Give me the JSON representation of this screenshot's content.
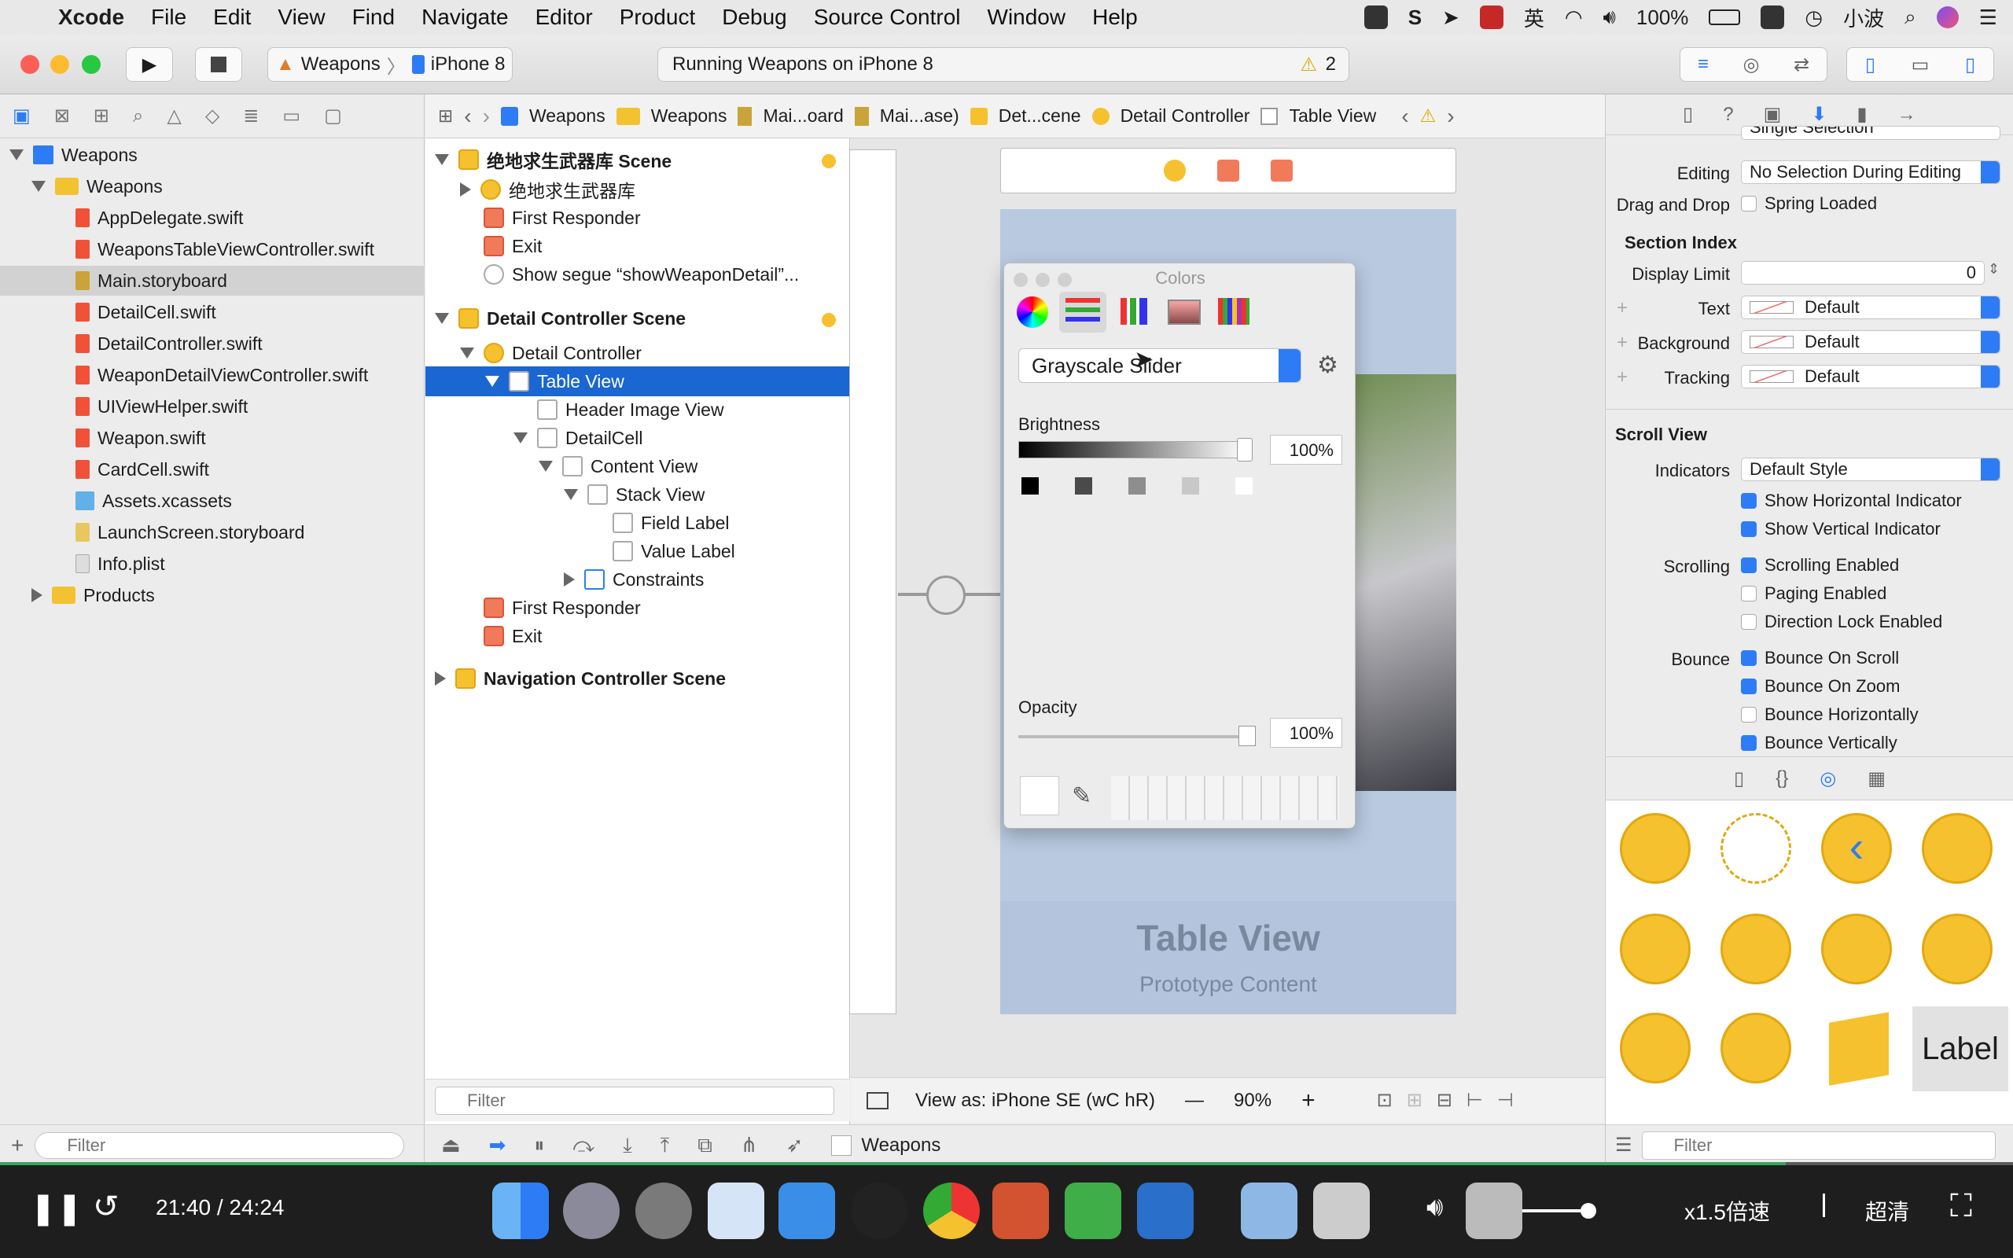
{
  "menubar": {
    "app": "Xcode",
    "items": [
      "File",
      "Edit",
      "View",
      "Find",
      "Navigate",
      "Editor",
      "Product",
      "Debug",
      "Source Control",
      "Window",
      "Help"
    ],
    "status": {
      "ime": "英",
      "battery": "100%",
      "user": "小波"
    }
  },
  "toolbar": {
    "scheme_target": "Weapons",
    "scheme_device": "iPhone 8",
    "activity": "Running Weapons on iPhone 8",
    "warnings": "2"
  },
  "navigator": {
    "items": [
      {
        "label": "Weapons",
        "kind": "project"
      },
      {
        "label": "Weapons",
        "kind": "folder"
      },
      {
        "label": "AppDelegate.swift",
        "kind": "swift"
      },
      {
        "label": "WeaponsTableViewController.swift",
        "kind": "swift"
      },
      {
        "label": "Main.storyboard",
        "kind": "storyboard"
      },
      {
        "label": "DetailCell.swift",
        "kind": "swift"
      },
      {
        "label": "DetailController.swift",
        "kind": "swift"
      },
      {
        "label": "WeaponDetailViewController.swift",
        "kind": "swift"
      },
      {
        "label": "UIViewHelper.swift",
        "kind": "swift"
      },
      {
        "label": "Weapon.swift",
        "kind": "swift"
      },
      {
        "label": "CardCell.swift",
        "kind": "swift"
      },
      {
        "label": "Assets.xcassets",
        "kind": "assets"
      },
      {
        "label": "LaunchScreen.storyboard",
        "kind": "storyboard"
      },
      {
        "label": "Info.plist",
        "kind": "plist"
      },
      {
        "label": "Products",
        "kind": "folder"
      }
    ],
    "filter_placeholder": "Filter"
  },
  "jumpbar": [
    "Weapons",
    "Weapons",
    "Mai...oard",
    "Mai...ase)",
    "Det...cene",
    "Detail Controller",
    "Table View"
  ],
  "outline": {
    "rows": [
      "绝地求生武器库 Scene",
      "绝地求生武器库",
      "First Responder",
      "Exit",
      "Show segue “showWeaponDetail”...",
      "Detail Controller Scene",
      "Detail Controller",
      "Table View",
      "Header Image View",
      "DetailCell",
      "Content View",
      "Stack View",
      "Field Label",
      "Value Label",
      "Constraints",
      "First Responder",
      "Exit",
      "Navigation Controller Scene"
    ],
    "filter_placeholder": "Filter"
  },
  "canvas": {
    "title": "Table View",
    "subtitle": "Prototype Content",
    "view_as": "View as: iPhone SE (wC hR)",
    "zoom": "90%",
    "bottom_label": "Weapons"
  },
  "colors_panel": {
    "title": "Colors",
    "mode": "Grayscale Slider",
    "brightness_label": "Brightness",
    "brightness_value": "100%",
    "opacity_label": "Opacity",
    "opacity_value": "100%"
  },
  "inspector": {
    "selection_value": "Single Selection",
    "editing_label": "Editing",
    "editing_value": "No Selection During Editing",
    "drag_label": "Drag and Drop",
    "spring": "Spring Loaded",
    "section_index": "Section Index",
    "display_limit_label": "Display Limit",
    "display_limit_value": "0",
    "text_label": "Text",
    "background_label": "Background",
    "tracking_label": "Tracking",
    "default": "Default",
    "scroll_view": "Scroll View",
    "indicators_label": "Indicators",
    "indicators_value": "Default Style",
    "show_h": "Show Horizontal Indicator",
    "show_v": "Show Vertical Indicator",
    "scrolling_label": "Scrolling",
    "scrolling_enabled": "Scrolling Enabled",
    "paging": "Paging Enabled",
    "direction_lock": "Direction Lock Enabled",
    "bounce_label": "Bounce",
    "bounce_scroll": "Bounce On Scroll",
    "bounce_zoom": "Bounce On Zoom",
    "bounce_h": "Bounce Horizontally",
    "bounce_v": "Bounce Vertically",
    "library_label": "Label",
    "filter_placeholder": "Filter"
  },
  "player": {
    "time": "21:40 / 24:24",
    "speed": "x1.5倍速",
    "quality": "超清",
    "progress_fraction": 0.887
  }
}
